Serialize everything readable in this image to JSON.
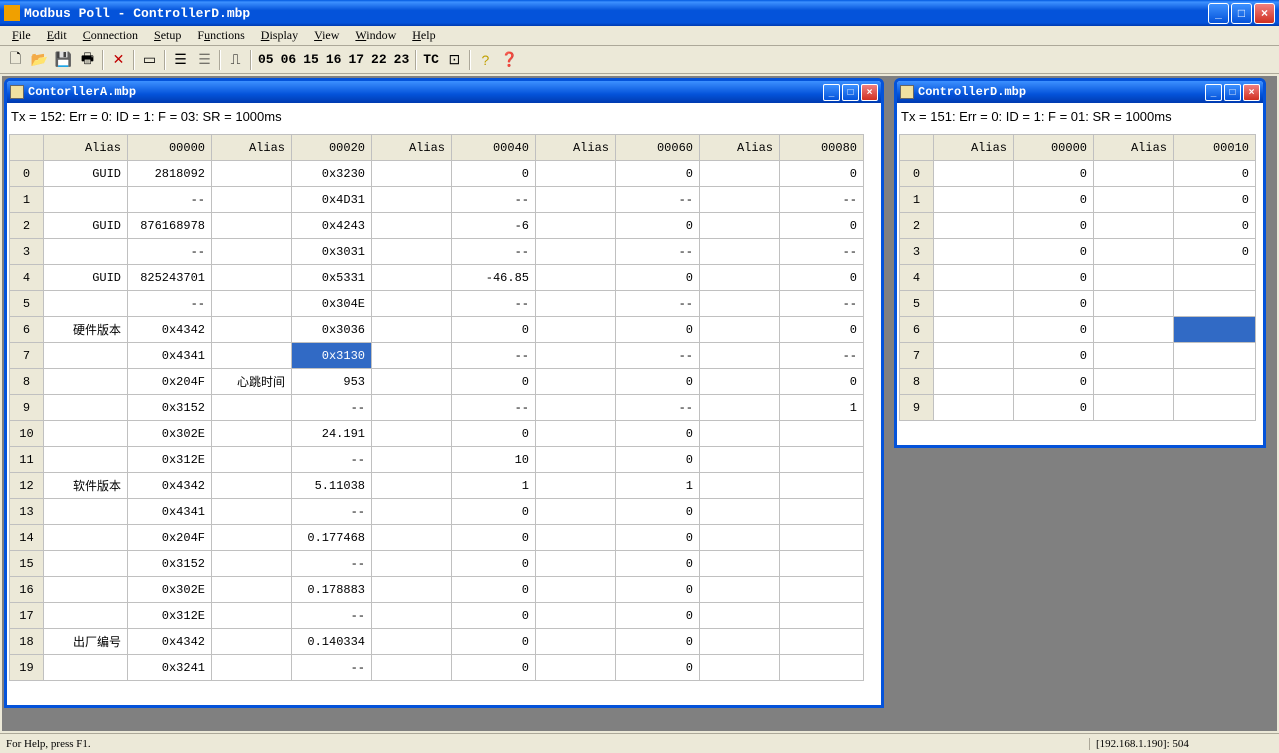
{
  "app": {
    "title": "Modbus Poll - ControllerD.mbp"
  },
  "menu": {
    "file": "File",
    "edit": "Edit",
    "connection": "Connection",
    "setup": "Setup",
    "functions": "Functions",
    "display": "Display",
    "view": "View",
    "window": "Window",
    "help": "Help"
  },
  "toolbar": {
    "codes": [
      "05",
      "06",
      "15",
      "16",
      "17",
      "22",
      "23"
    ],
    "tc": "TC"
  },
  "windowA": {
    "title": "ContorllerA.mbp",
    "status": "Tx = 152: Err = 0: ID = 1: F = 03: SR = 1000ms",
    "headers": [
      "Alias",
      "00000",
      "Alias",
      "00020",
      "Alias",
      "00040",
      "Alias",
      "00060",
      "Alias",
      "00080"
    ],
    "rows": [
      [
        "GUID",
        "2818092",
        "",
        "0x3230",
        "",
        "0",
        "",
        "0",
        "",
        "0"
      ],
      [
        "",
        "--",
        "",
        "0x4D31",
        "",
        "--",
        "",
        "--",
        "",
        "--"
      ],
      [
        "GUID",
        "876168978",
        "",
        "0x4243",
        "",
        "-6",
        "",
        "0",
        "",
        "0"
      ],
      [
        "",
        "--",
        "",
        "0x3031",
        "",
        "--",
        "",
        "--",
        "",
        "--"
      ],
      [
        "GUID",
        "825243701",
        "",
        "0x5331",
        "",
        "-46.85",
        "",
        "0",
        "",
        "0"
      ],
      [
        "",
        "--",
        "",
        "0x304E",
        "",
        "--",
        "",
        "--",
        "",
        "--"
      ],
      [
        "硬件版本",
        "0x4342",
        "",
        "0x3036",
        "",
        "0",
        "",
        "0",
        "",
        "0"
      ],
      [
        "",
        "0x4341",
        "",
        "0x3130",
        "",
        "--",
        "",
        "--",
        "",
        "--"
      ],
      [
        "",
        "0x204F",
        "心跳时间",
        "953",
        "",
        "0",
        "",
        "0",
        "",
        "0"
      ],
      [
        "",
        "0x3152",
        "",
        "--",
        "",
        "--",
        "",
        "--",
        "",
        "1"
      ],
      [
        "",
        "0x302E",
        "",
        "24.191",
        "",
        "0",
        "",
        "0",
        "",
        ""
      ],
      [
        "",
        "0x312E",
        "",
        "--",
        "",
        "10",
        "",
        "0",
        "",
        ""
      ],
      [
        "软件版本",
        "0x4342",
        "",
        "5.11038",
        "",
        "1",
        "",
        "1",
        "",
        ""
      ],
      [
        "",
        "0x4341",
        "",
        "--",
        "",
        "0",
        "",
        "0",
        "",
        ""
      ],
      [
        "",
        "0x204F",
        "",
        "0.177468",
        "",
        "0",
        "",
        "0",
        "",
        ""
      ],
      [
        "",
        "0x3152",
        "",
        "--",
        "",
        "0",
        "",
        "0",
        "",
        ""
      ],
      [
        "",
        "0x302E",
        "",
        "0.178883",
        "",
        "0",
        "",
        "0",
        "",
        ""
      ],
      [
        "",
        "0x312E",
        "",
        "--",
        "",
        "0",
        "",
        "0",
        "",
        ""
      ],
      [
        "出厂编号",
        "0x4342",
        "",
        "0.140334",
        "",
        "0",
        "",
        "0",
        "",
        ""
      ],
      [
        "",
        "0x3241",
        "",
        "--",
        "",
        "0",
        "",
        "0",
        "",
        ""
      ]
    ],
    "selected": {
      "row": 7,
      "col": 3
    }
  },
  "windowD": {
    "title": "ControllerD.mbp",
    "status": "Tx = 151: Err = 0: ID = 1: F = 01: SR = 1000ms",
    "headers": [
      "Alias",
      "00000",
      "Alias",
      "00010"
    ],
    "rows": [
      [
        "",
        "0",
        "",
        "0"
      ],
      [
        "",
        "0",
        "",
        "0"
      ],
      [
        "",
        "0",
        "",
        "0"
      ],
      [
        "",
        "0",
        "",
        "0"
      ],
      [
        "",
        "0",
        "",
        ""
      ],
      [
        "",
        "0",
        "",
        ""
      ],
      [
        "",
        "0",
        "",
        ""
      ],
      [
        "",
        "0",
        "",
        ""
      ],
      [
        "",
        "0",
        "",
        ""
      ],
      [
        "",
        "0",
        "",
        ""
      ]
    ],
    "selected": {
      "row": 6,
      "col": 3
    }
  },
  "statusbar": {
    "left": "For Help, press F1.",
    "right": "[192.168.1.190]: 504"
  }
}
